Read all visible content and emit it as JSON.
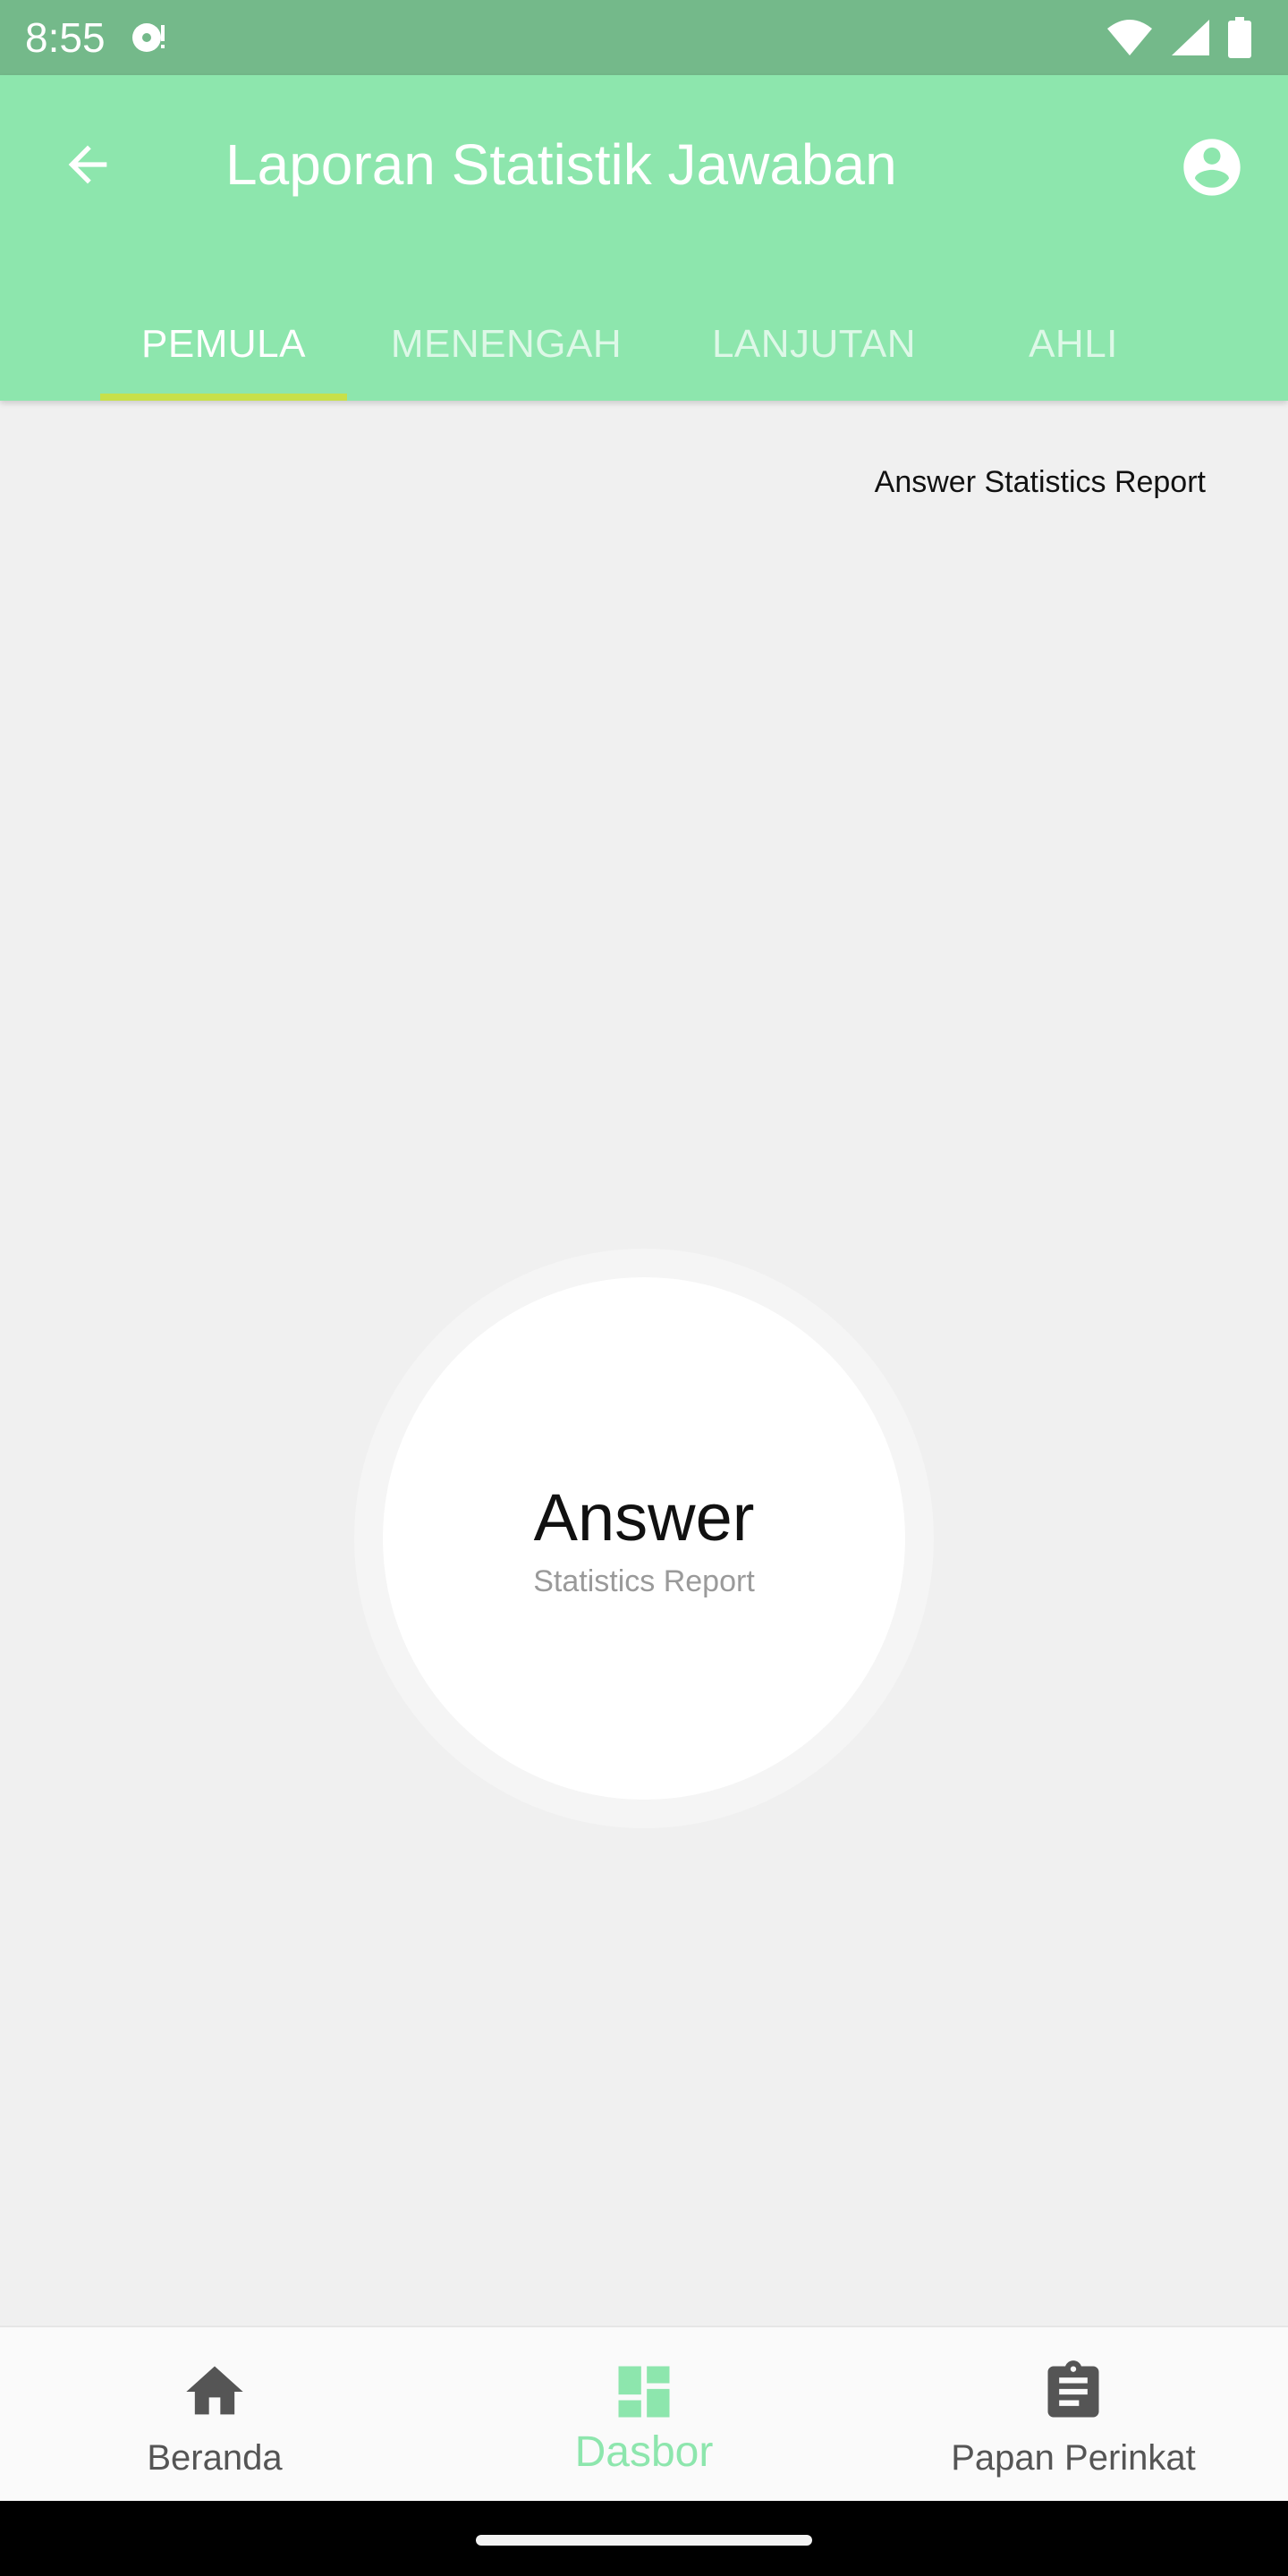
{
  "status_bar": {
    "time": "8:55",
    "icons": [
      "music-note-notification-icon",
      "wifi-icon",
      "cellular-signal-icon",
      "battery-icon"
    ]
  },
  "app_bar": {
    "title": "Laporan Statistik Jawaban",
    "icons": [
      "arrow-back-icon",
      "account-circle-icon"
    ],
    "background_color": "#8de6ad"
  },
  "tabs": [
    {
      "label": "PEMULA",
      "active": true
    },
    {
      "label": "MENENGAH",
      "active": false
    },
    {
      "label": "LANJUTAN",
      "active": false
    },
    {
      "label": "AHLI",
      "active": false
    }
  ],
  "tab_indicator_color": "#c7e04a",
  "chart": {
    "description": "Answer Statistics Report",
    "center_title": "Answer",
    "center_subtitle": "Statistics Report"
  },
  "chart_data": {
    "type": "pie",
    "title": "Answer Statistics Report",
    "center_text": "Answer",
    "center_subtext": "Statistics Report",
    "series": [],
    "values": []
  },
  "bottom_nav": {
    "items": [
      {
        "label": "Beranda",
        "icon": "home-icon",
        "active": false
      },
      {
        "label": "Dasbor",
        "icon": "dashboard-icon",
        "active": true
      },
      {
        "label": "Papan Perinkat",
        "icon": "clipboard-icon",
        "active": false
      }
    ],
    "active_color": "#8de6ad"
  }
}
